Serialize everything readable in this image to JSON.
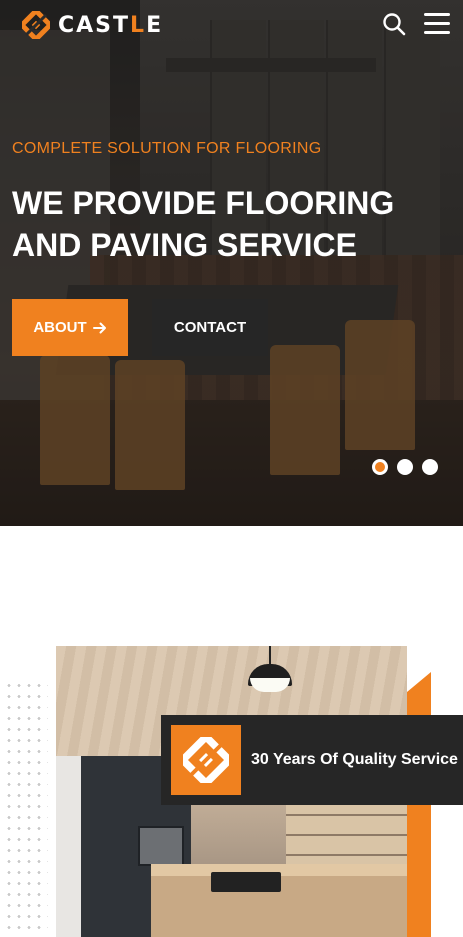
{
  "header": {
    "logo_text_start": "CAST",
    "logo_text_accent": "L",
    "logo_text_end": "E",
    "search_icon": "search-icon",
    "menu_icon": "hamburger-menu-icon"
  },
  "hero": {
    "eyebrow": "COMPLETE SOLUTION FOR FLOORING",
    "headline": "WE PROVIDE FLOORING AND PAVING SERVICE",
    "about_label": "ABOUT",
    "about_icon": "arrow-right-icon",
    "contact_label": "CONTACT",
    "slides_total": 3,
    "active_slide": 1
  },
  "about": {
    "service_badge": "30 Years Of Quality Service",
    "service_icon": "diamond-logo-icon"
  },
  "colors": {
    "accent": "#f0811f",
    "dark": "#262626",
    "white": "#ffffff"
  }
}
